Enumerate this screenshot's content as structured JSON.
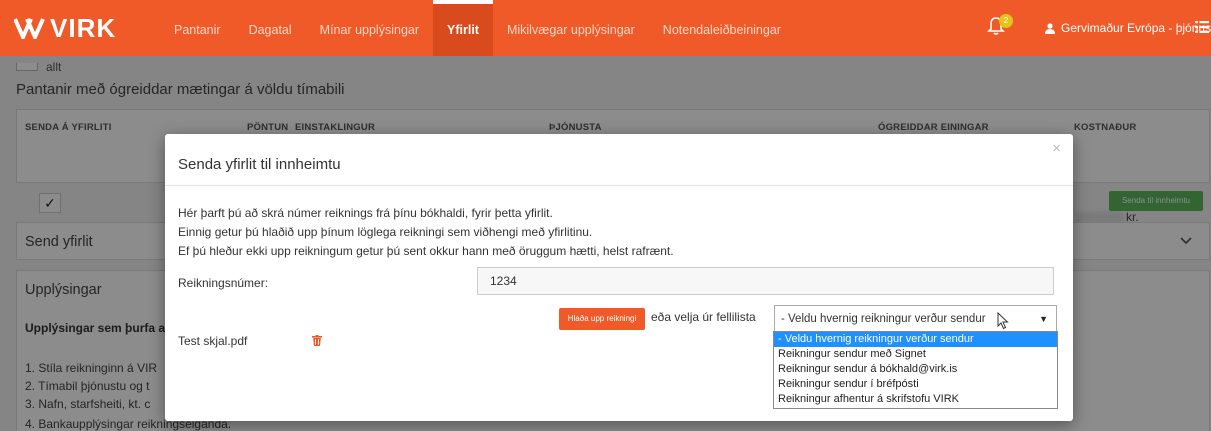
{
  "header": {
    "logo_text": "VIRK",
    "nav": [
      "Pantanir",
      "Dagatal",
      "Mínar upplýsingar",
      "Yfirlit",
      "Mikilvægar upplýsingar",
      "Notendaleiðbeiningar"
    ],
    "active_nav": "Yfirlit",
    "notification_count": "2",
    "user_name": "Gervimaður Evrópa - þjónustuaðili"
  },
  "background": {
    "checkbox_all_label": "allt",
    "section_title": "Pantanir með ógreiddar mætingar á völdu tímabili",
    "columns": [
      "SENDA Á YFIRLITI",
      "PÖNTUN",
      "EINSTAKLINGUR",
      "ÞJÓNUSTA",
      "ÓGREIDDAR EININGAR",
      "KOSTNAÐUR"
    ],
    "row_check": "✓",
    "cost_unit": "kr.",
    "send_button": "Senda til innheimtu",
    "send_section": "Send yfirlit",
    "info_section": "Upplýsingar",
    "info_bold": "Upplýsingar sem þurfa a",
    "info_lines": [
      "1. Stíla reikninginn á VIR",
      "2. Tímabil þjónustu og t",
      "3. Nafn, starfsheiti, kt. c",
      "4. Bankaupplýsingar reikningseiganda."
    ]
  },
  "modal": {
    "title": "Senda yfirlit til innheimtu",
    "close": "×",
    "description": [
      "Hér þarft þú að skrá númer reiknings frá þínu bókhaldi,  fyrir þetta yfirlit.",
      "Einnig getur þú hlaðið upp þínum löglega reikningi sem viðhengi með yfirlitinu.",
      "Ef þú hleður ekki upp reikningum  getur þú sent okkur hann með öruggum hætti, helst rafrænt."
    ],
    "invoice_label": "Reikningsnúmer:",
    "invoice_value": "1234",
    "upload_button": "Hlaða upp reikningi",
    "or_text": "eða velja úr fellilista",
    "select_value": "- Veldu hvernig reikningur verður sendur",
    "file_name": "Test skjal.pdf",
    "options": [
      "- Veldu hvernig reikningur verður sendur",
      "Reikningur sendur með Signet",
      "Reikningur sendur á bókhald@virk.is",
      "Reikningur sendur í bréfpósti",
      "Reikningur afhentur á skrifstofu VIRK"
    ]
  },
  "colors": {
    "brand": "#ef5a28",
    "success": "#5cb85c",
    "selected_option": "#1e90ff"
  },
  "icons": [
    "virk-logo-icon",
    "bell-icon",
    "user-icon",
    "power-icon",
    "menu-icon",
    "close-icon",
    "chevron-down-icon",
    "caret-down-icon",
    "trash-icon",
    "cursor-icon"
  ]
}
